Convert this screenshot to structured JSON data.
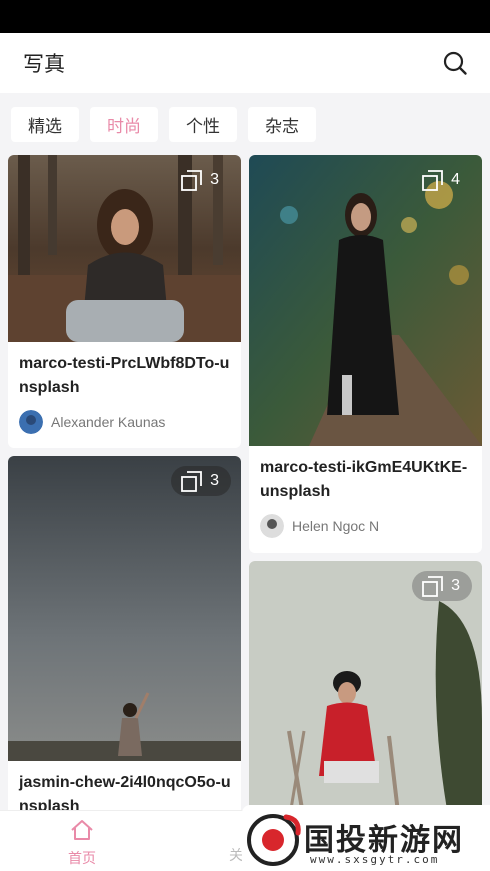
{
  "header": {
    "title": "写真"
  },
  "tabs": [
    {
      "label": "精选",
      "active": false
    },
    {
      "label": "时尚",
      "active": true
    },
    {
      "label": "个性",
      "active": false
    },
    {
      "label": "杂志",
      "active": false
    }
  ],
  "cards": [
    {
      "title": "marco-testi-PrcLWbf8DTo-unsplash",
      "author": "Alexander Kaunas",
      "count": "3"
    },
    {
      "title": "marco-testi-ikGmE4UKtKE-unsplash",
      "author": "Helen Ngoc N",
      "count": "4"
    },
    {
      "title": "jasmin-chew-2i4l0nqcO5o-unsplash",
      "author": "",
      "count": "3"
    },
    {
      "title": "",
      "author": "",
      "count": "3"
    }
  ],
  "nav": {
    "home_label": "首页",
    "second_label": "关"
  },
  "watermark": {
    "text": "国投新游网",
    "url": "www.sxsgytr.com"
  },
  "colors": {
    "accent": "#e98aa8",
    "background": "#f4f4f6"
  }
}
